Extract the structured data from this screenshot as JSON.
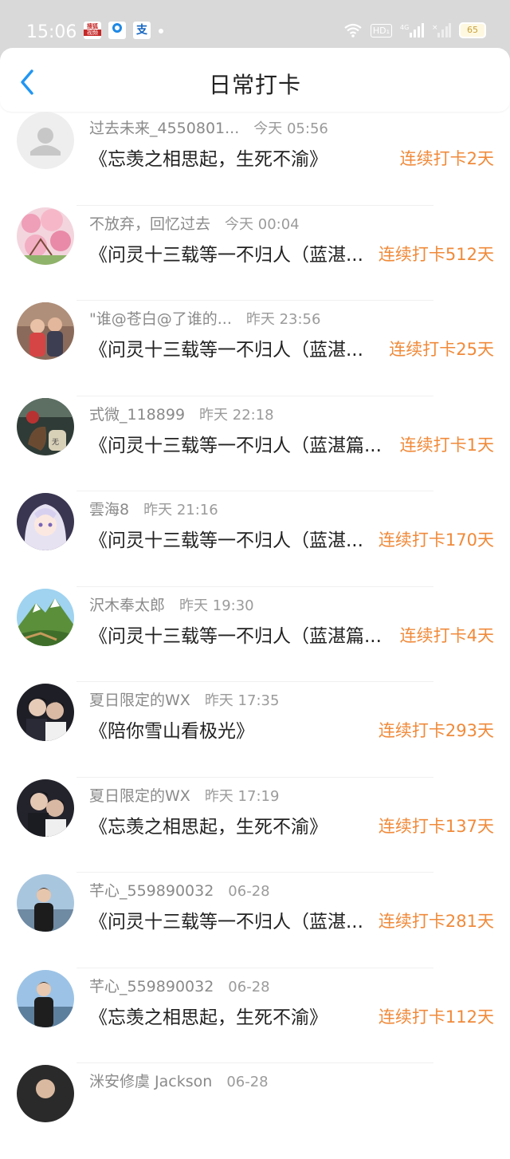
{
  "status_bar": {
    "time": "15:06",
    "network": "4G",
    "battery": "65",
    "hd": "HD₁"
  },
  "header": {
    "title": "日常打卡"
  },
  "colors": {
    "streak": "#f08a3a",
    "back": "#2196f3"
  },
  "items": [
    {
      "name": "过去未来_4550801...",
      "time": "今天 05:56",
      "title": "《忘羡之相思起，生死不渝》",
      "streak": "连续打卡2天",
      "avatar": "default-avatar"
    },
    {
      "name": "不放弃，回忆过去",
      "time": "今天 00:04",
      "title": "《问灵十三载等一不归人（蓝湛...",
      "streak": "连续打卡512天",
      "avatar": "pink-blossom"
    },
    {
      "name": "\"谁@苍白@了谁的...",
      "time": "昨天 23:56",
      "title": "《问灵十三载等一不归人（蓝湛...",
      "streak": "连续打卡25天",
      "avatar": "children-photo"
    },
    {
      "name": "式微_118899",
      "time": "昨天 22:18",
      "title": "《问灵十三载等一不归人（蓝湛篇...",
      "streak": "连续打卡1天",
      "avatar": "teal-still-life"
    },
    {
      "name": "雲海8",
      "time": "昨天 21:16",
      "title": "《问灵十三载等一不归人（蓝湛...",
      "streak": "连续打卡170天",
      "avatar": "anime-girl"
    },
    {
      "name": "沢木奉太郎",
      "time": "昨天 19:30",
      "title": "《问灵十三载等一不归人（蓝湛篇...",
      "streak": "连续打卡4天",
      "avatar": "mountain-landscape"
    },
    {
      "name": "夏日限定的WX",
      "time": "昨天 17:35",
      "title": "《陪你雪山看极光》",
      "streak": "连续打卡293天",
      "avatar": "two-men-dark"
    },
    {
      "name": "夏日限定的WX",
      "time": "昨天 17:19",
      "title": "《忘羡之相思起，生死不渝》",
      "streak": "连续打卡137天",
      "avatar": "two-men-dark"
    },
    {
      "name": "芊心_559890032",
      "time": "06-28",
      "title": "《问灵十三载等一不归人（蓝湛...",
      "streak": "连续打卡281天",
      "avatar": "woman-photo"
    },
    {
      "name": "芊心_559890032",
      "time": "06-28",
      "title": "《忘羡之相思起，生死不渝》",
      "streak": "连续打卡112天",
      "avatar": "woman-photo"
    },
    {
      "name": "洣安修虞 Jackson",
      "time": "06-28",
      "title": "",
      "streak": "",
      "avatar": "partial-avatar"
    }
  ]
}
